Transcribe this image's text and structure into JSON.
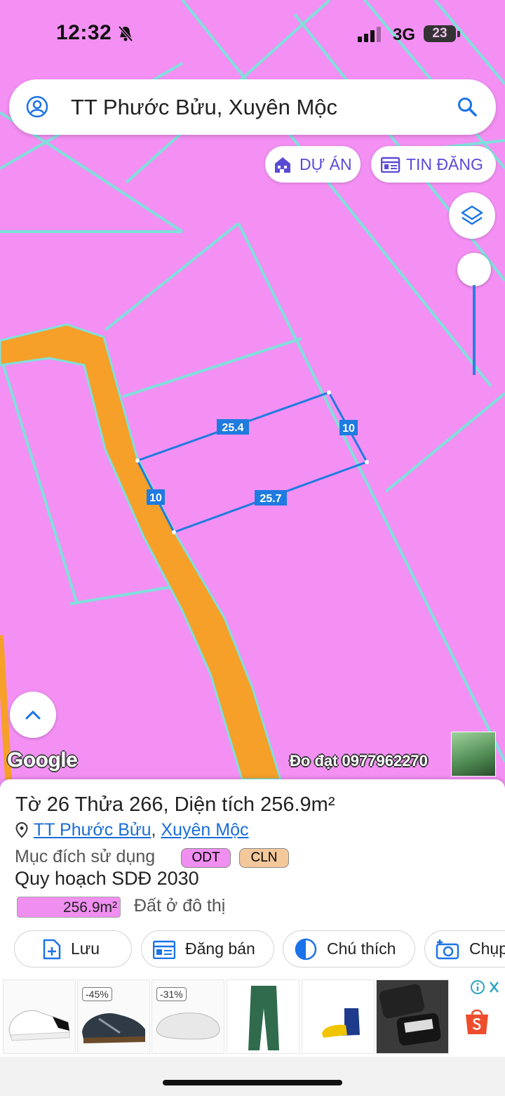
{
  "status_bar": {
    "time": "12:32",
    "network": "3G",
    "battery": "23",
    "icons": [
      "bell-slash-icon",
      "signal-icon"
    ]
  },
  "search": {
    "query": "TT Phước Bửu, Xuyên Mộc",
    "icons": [
      "user-icon",
      "search-icon"
    ]
  },
  "map_buttons": {
    "du_an": "DỰ ÁN",
    "tin_dang": "TIN ĐĂNG",
    "icons": [
      "building-icon",
      "listing-icon",
      "layers-icon",
      "chevron-up-icon"
    ]
  },
  "map": {
    "colors": {
      "land": "#f490f4",
      "road": "#f6a02a",
      "boundary": "#7fe0da",
      "measure": "#1f7be0"
    },
    "measurements": [
      "25.4",
      "10",
      "10",
      "25.7"
    ],
    "attribution": "Google",
    "watermark": "Đo đạt 0977962270"
  },
  "parcel": {
    "sheet_label": "Tờ",
    "sheet": "26",
    "plot_label": "Thửa",
    "plot": "266",
    "area_label": "Diện tích",
    "area": "256.9m²",
    "ward": "TT Phước Bửu",
    "district": "Xuyên Mộc",
    "purpose_label": "Mục đích sử dụng",
    "purpose_tags": [
      "ODT",
      "CLN"
    ],
    "plan_label": "Quy hoạch SDĐ 2030",
    "plan_area": "256.9m²",
    "plan_use": "Đất ở đô thị"
  },
  "actions": [
    {
      "label": "Lưu",
      "icon": "add-file-icon"
    },
    {
      "label": "Đăng bán",
      "icon": "listing-icon"
    },
    {
      "label": "Chú thích",
      "icon": "legend-icon"
    },
    {
      "label": "Chụp",
      "icon": "camera-icon"
    }
  ],
  "ads": {
    "discounts": [
      "-45%",
      "-31%"
    ],
    "icons": [
      "info-icon",
      "close-icon",
      "shopee-icon"
    ]
  }
}
